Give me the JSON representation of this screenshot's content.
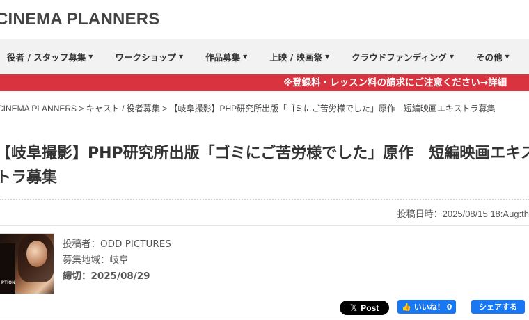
{
  "header": {
    "logo": "CINEMA PLANNERS"
  },
  "nav": {
    "items": [
      {
        "label": "役者 / スタッフ募集"
      },
      {
        "label": "ワークショップ"
      },
      {
        "label": "作品募集"
      },
      {
        "label": "上映 / 映画祭"
      },
      {
        "label": "クラウドファンディング"
      },
      {
        "label": "その他"
      }
    ]
  },
  "warning": {
    "text": "※登録料・レッスン料の請求にご注意ください→詳細"
  },
  "breadcrumb": {
    "items": [
      "CINEMA PLANNERS",
      "キャスト / 役者募集",
      "【岐阜撮影】PHP研究所出版「ゴミにご苦労様でした」原作　短編映画エキストラ募集"
    ],
    "separator": ">"
  },
  "article": {
    "title": "【岐阜撮影】PHP研究所出版「ゴミにご苦労様でした」原作　短編映画エキストラ募集",
    "posted": "投稿日時：2025/08/15 18:Aug:th",
    "thumbnail_caption": "PTION",
    "poster": "投稿者：ODD PICTURES",
    "region": "募集地域：岐阜",
    "deadline": "締切：2025/08/29"
  },
  "social": {
    "x_post": "Post",
    "like_label": "いいね！",
    "like_count": "0",
    "share_label": "シェアする",
    "colors": {
      "facebook": "#1877f2",
      "x": "#000000",
      "warning": "#d9333f"
    }
  }
}
